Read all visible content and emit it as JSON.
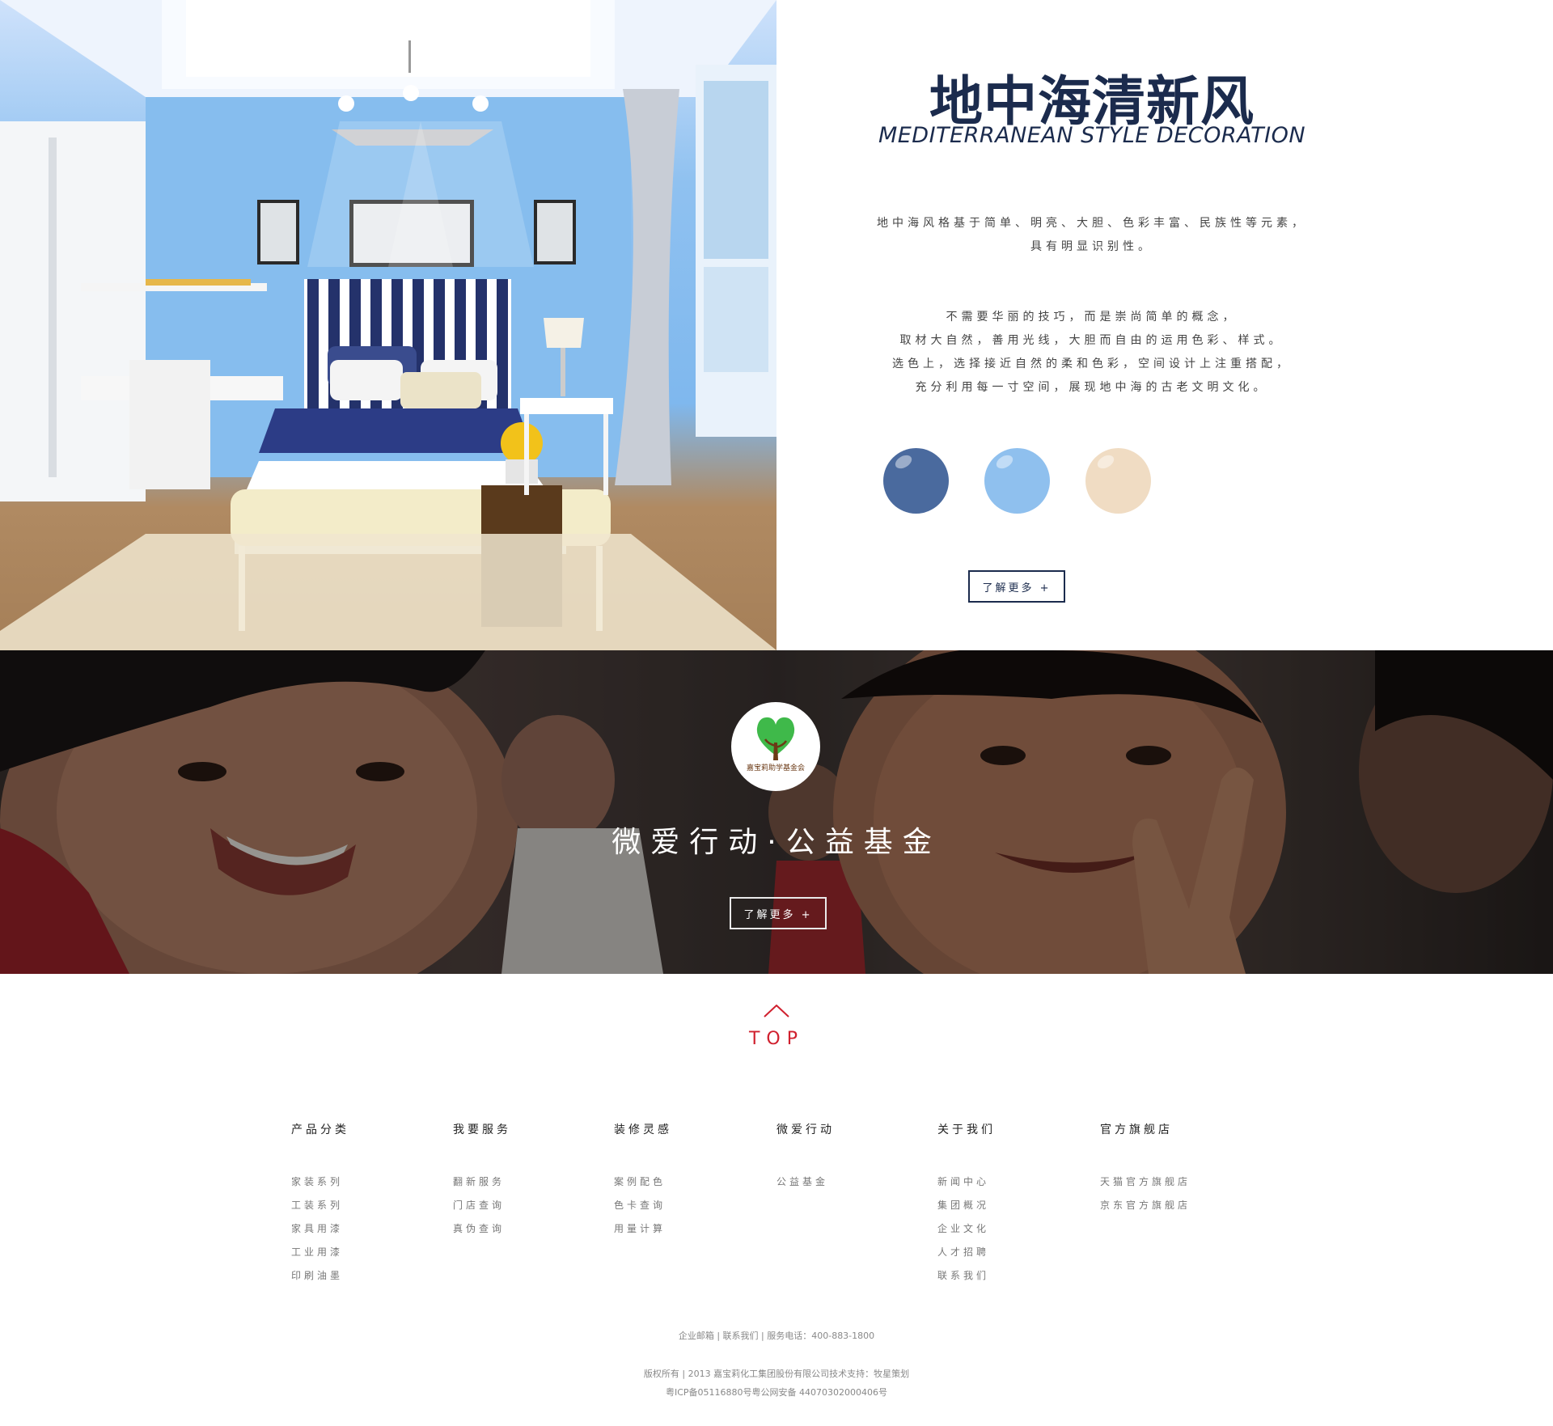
{
  "mediterranean": {
    "title": "地中海清新风",
    "subtitle": "MEDITERRANEAN STYLE DECORATION",
    "paragraphs": [
      "地中海风格基于简单、明亮、大胆、色彩丰富、民族性等元素，",
      "具有明显识别性。",
      "不需要华丽的技巧，而是崇尚简单的概念，",
      "取材大自然，善用光线，大胆而自由的运用色彩、样式。",
      "选色上，选择接近自然的柔和色彩，空间设计上注重搭配，",
      "充分利用每一寸空间，展现地中海的古老文明文化。"
    ],
    "swatch_colors": [
      "#4a6a9e",
      "#8fc0ee",
      "#f0dcc3"
    ],
    "more_label": "了解更多 +"
  },
  "charity": {
    "logo_text": "嘉宝莉助学基金会",
    "title": "微爱行动·公益基金",
    "more_label": "了解更多 +"
  },
  "top": {
    "label": "TOP"
  },
  "footer": {
    "columns": [
      {
        "heading": "产品分类",
        "links": [
          "家装系列",
          "工装系列",
          "家具用漆",
          "工业用漆",
          "印刷油墨"
        ]
      },
      {
        "heading": "我要服务",
        "links": [
          "翻新服务",
          "门店查询",
          "真伪查询"
        ]
      },
      {
        "heading": "装修灵感",
        "links": [
          "案例配色",
          "色卡查询",
          "用量计算"
        ]
      },
      {
        "heading": "微爱行动",
        "links": [
          "公益基金"
        ]
      },
      {
        "heading": "关于我们",
        "links": [
          "新闻中心",
          "集团概况",
          "企业文化",
          "人才招聘",
          "联系我们"
        ]
      },
      {
        "heading": "官方旗舰店",
        "links": [
          "天猫官方旗舰店",
          "京东官方旗舰店"
        ]
      }
    ],
    "contact_line": "企业邮箱 | 联系我们 | 服务电话：400-883-1800",
    "copyright_line": "版权所有 | 2013 嘉宝莉化工集团股份有限公司技术支持：牧星策划",
    "icp_line": "粤ICP备05116880号粤公网安备 44070302000406号"
  },
  "colors": {
    "navy": "#1b2b4d",
    "top_red": "#d0202e",
    "logo_green": "#3fb94a"
  }
}
